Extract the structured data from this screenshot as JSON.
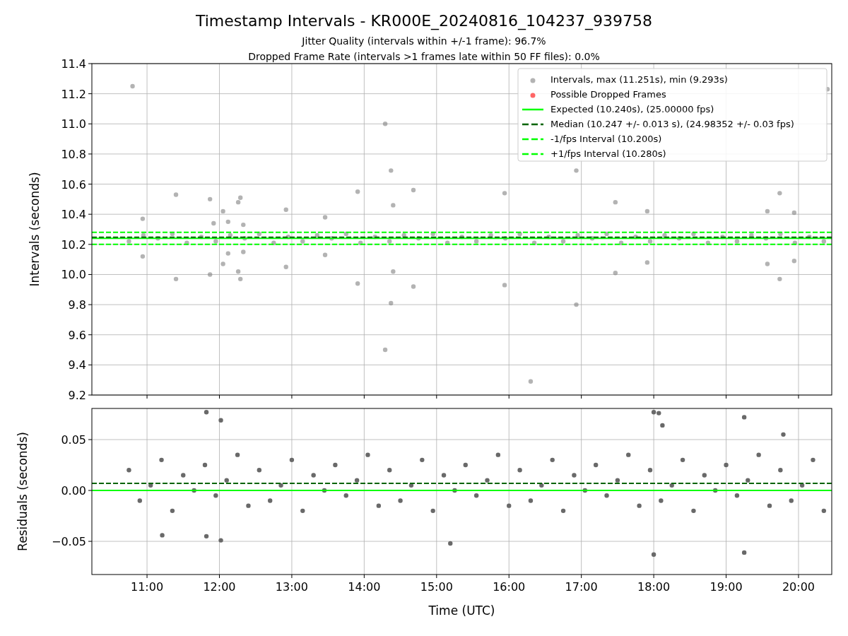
{
  "figure": {
    "title": "Timestamp Intervals - KR000E_20240816_104237_939758",
    "subtitles": [
      "Jitter Quality (intervals within +/-1 frame): 96.7%",
      "Dropped Frame Rate (intervals >1 frames late within 50 FF files): 0.0%"
    ]
  },
  "charts": [
    {
      "chart_data": {
        "type": "scatter",
        "grid": true,
        "legend": true,
        "ylabel": "Intervals (seconds)",
        "xlim": [
          10.238,
          20.459
        ],
        "ylim": [
          9.2,
          11.4
        ],
        "yticks": [
          {
            "value": 9.2,
            "label": "9.2"
          },
          {
            "value": 9.4,
            "label": "9.4"
          },
          {
            "value": 9.6,
            "label": "9.6"
          },
          {
            "value": 9.8,
            "label": "9.8"
          },
          {
            "value": 10.0,
            "label": "10.0"
          },
          {
            "value": 10.2,
            "label": "10.2"
          },
          {
            "value": 10.4,
            "label": "10.4"
          },
          {
            "value": 10.6,
            "label": "10.6"
          },
          {
            "value": 10.8,
            "label": "10.8"
          },
          {
            "value": 11.0,
            "label": "11.0"
          },
          {
            "value": 11.2,
            "label": "11.2"
          },
          {
            "value": 11.4,
            "label": "11.4"
          }
        ],
        "series": [
          {
            "name": "Intervals, max (11.251s), min (9.293s)",
            "type": "scatter",
            "color": "#808080",
            "x": [
              10.8,
              10.94,
              10.94,
              11.4,
              11.4,
              11.87,
              11.87,
              11.92,
              12.05,
              12.05,
              12.12,
              12.12,
              12.26,
              12.29,
              12.26,
              12.29,
              12.33,
              12.33,
              12.92,
              12.92,
              13.46,
              13.46,
              13.91,
              13.91,
              14.29,
              14.29,
              14.37,
              14.4,
              14.4,
              14.37,
              14.68,
              14.68,
              15.94,
              15.94,
              16.3,
              16.93,
              16.93,
              17.47,
              17.47,
              17.91,
              17.91,
              19.57,
              19.57,
              19.74,
              19.74,
              19.94,
              19.94,
              20.4,
              10.75,
              10.95,
              11.15,
              11.35,
              11.55,
              11.75,
              11.95,
              12.15,
              12.35,
              12.55,
              12.75,
              12.95,
              13.15,
              13.35,
              13.55,
              13.75,
              13.95,
              14.15,
              14.35,
              14.55,
              14.75,
              14.95,
              15.15,
              15.35,
              15.55,
              15.75,
              15.95,
              16.15,
              16.35,
              16.55,
              16.75,
              16.95,
              17.15,
              17.35,
              17.55,
              17.75,
              17.95,
              18.15,
              18.35,
              18.55,
              18.75,
              18.95,
              19.15,
              19.35,
              19.55,
              19.75,
              19.95,
              20.15,
              20.35
            ],
            "values": [
              11.25,
              10.37,
              10.12,
              10.53,
              9.97,
              10.5,
              10.0,
              10.34,
              10.42,
              10.07,
              10.35,
              10.14,
              10.48,
              10.51,
              10.02,
              9.97,
              10.15,
              10.33,
              10.43,
              10.05,
              10.38,
              10.13,
              10.55,
              9.94,
              11.0,
              9.5,
              10.69,
              10.46,
              10.02,
              9.81,
              10.56,
              9.92,
              10.54,
              9.93,
              9.29,
              10.69,
              9.8,
              10.48,
              10.01,
              10.42,
              10.08,
              10.42,
              10.07,
              10.54,
              9.97,
              10.41,
              10.09,
              11.23,
              10.22,
              10.26,
              10.24,
              10.27,
              10.21,
              10.25,
              10.22,
              10.26,
              10.24,
              10.27,
              10.21,
              10.25,
              10.22,
              10.26,
              10.24,
              10.27,
              10.21,
              10.25,
              10.22,
              10.26,
              10.24,
              10.27,
              10.21,
              10.25,
              10.22,
              10.26,
              10.24,
              10.27,
              10.21,
              10.25,
              10.22,
              10.26,
              10.24,
              10.27,
              10.21,
              10.25,
              10.22,
              10.26,
              10.24,
              10.27,
              10.21,
              10.25,
              10.22,
              10.26,
              10.24,
              10.27,
              10.21,
              10.25,
              10.22
            ]
          },
          {
            "name": "Possible Dropped Frames",
            "type": "scatter",
            "color": "#ff0000"
          },
          {
            "name": "Expected (10.240s), (25.00000 fps)",
            "type": "line",
            "line_style": "solid",
            "color": "#00ff00",
            "x": [
              10.238,
              20.459
            ],
            "values": [
              10.24,
              10.24
            ]
          },
          {
            "name": "Median (10.247 +/- 0.013 s), (24.98352 +/- 0.03 fps)",
            "type": "line",
            "line_style": "dashed",
            "color": "#006400",
            "x": [
              10.238,
              20.459
            ],
            "values": [
              10.247,
              10.247
            ]
          },
          {
            "name": "-1/fps Interval (10.200s)",
            "type": "line",
            "line_style": "dashed",
            "color": "#00ff00",
            "x": [
              10.238,
              20.459
            ],
            "values": [
              10.2,
              10.2
            ]
          },
          {
            "name": "+1/fps Interval (10.280s)",
            "type": "line",
            "line_style": "dashed",
            "color": "#00ff00",
            "x": [
              10.238,
              20.459
            ],
            "values": [
              10.28,
              10.28
            ]
          }
        ]
      }
    },
    {
      "chart_data": {
        "type": "scatter",
        "grid": true,
        "xlabel": "Time (UTC)",
        "ylabel": "Residuals (seconds)",
        "xlim": [
          10.238,
          20.459
        ],
        "ylim": [
          -0.0826,
          0.0806
        ],
        "xticks": [
          {
            "value": 11,
            "label": "11:00"
          },
          {
            "value": 12,
            "label": "12:00"
          },
          {
            "value": 13,
            "label": "13:00"
          },
          {
            "value": 14,
            "label": "14:00"
          },
          {
            "value": 15,
            "label": "15:00"
          },
          {
            "value": 16,
            "label": "16:00"
          },
          {
            "value": 17,
            "label": "17:00"
          },
          {
            "value": 18,
            "label": "18:00"
          },
          {
            "value": 19,
            "label": "19:00"
          },
          {
            "value": 20,
            "label": "20:00"
          }
        ],
        "yticks": [
          {
            "value": -0.05,
            "label": "−0.05"
          },
          {
            "value": 0,
            "label": "0.00"
          },
          {
            "value": 0.05,
            "label": "0.05"
          }
        ],
        "series": [
          {
            "type": "scatter",
            "color": "#696969",
            "x": [
              11.82,
              12.02,
              11.82,
              12.02,
              11.21,
              15.19,
              18.0,
              18.07,
              18.12,
              18.0,
              19.25,
              19.25,
              19.79,
              10.75,
              10.9,
              11.05,
              11.2,
              11.35,
              11.5,
              11.65,
              11.8,
              11.95,
              12.1,
              12.25,
              12.4,
              12.55,
              12.7,
              12.85,
              13.0,
              13.15,
              13.3,
              13.45,
              13.6,
              13.75,
              13.9,
              14.05,
              14.2,
              14.35,
              14.5,
              14.65,
              14.8,
              14.95,
              15.1,
              15.25,
              15.4,
              15.55,
              15.7,
              15.85,
              16.0,
              16.15,
              16.3,
              16.45,
              16.6,
              16.75,
              16.9,
              17.05,
              17.2,
              17.35,
              17.5,
              17.65,
              17.8,
              17.95,
              18.1,
              18.25,
              18.4,
              18.55,
              18.7,
              18.85,
              19.0,
              19.15,
              19.3,
              19.45,
              19.6,
              19.75,
              19.9,
              20.05,
              20.2,
              20.35
            ],
            "values": [
              0.077,
              0.069,
              -0.045,
              -0.049,
              -0.044,
              -0.052,
              0.077,
              0.076,
              0.064,
              -0.063,
              0.072,
              -0.061,
              0.055,
              0.02,
              -0.01,
              0.005,
              0.03,
              -0.02,
              0.015,
              0.0,
              0.025,
              -0.005,
              0.01,
              0.035,
              -0.015,
              0.02,
              -0.01,
              0.005,
              0.03,
              -0.02,
              0.015,
              0.0,
              0.025,
              -0.005,
              0.01,
              0.035,
              -0.015,
              0.02,
              -0.01,
              0.005,
              0.03,
              -0.02,
              0.015,
              0.0,
              0.025,
              -0.005,
              0.01,
              0.035,
              -0.015,
              0.02,
              -0.01,
              0.005,
              0.03,
              -0.02,
              0.015,
              0.0,
              0.025,
              -0.005,
              0.01,
              0.035,
              -0.015,
              0.02,
              -0.01,
              0.005,
              0.03,
              -0.02,
              0.015,
              0.0,
              0.025,
              -0.005,
              0.01,
              0.035,
              -0.015,
              0.02,
              -0.01,
              0.005,
              0.03,
              -0.02
            ]
          },
          {
            "type": "line",
            "line_style": "solid",
            "color": "#00ff00",
            "x": [
              10.238,
              20.459
            ],
            "values": [
              0,
              0
            ]
          },
          {
            "type": "line",
            "line_style": "dashed",
            "color": "#006400",
            "x": [
              10.238,
              20.459
            ],
            "values": [
              0.007,
              0.007
            ]
          }
        ]
      }
    }
  ]
}
